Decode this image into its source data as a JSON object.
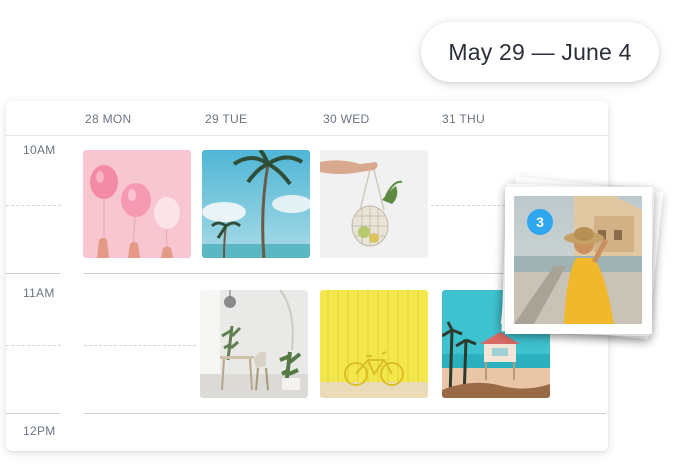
{
  "date_range": "May 29 — June 4",
  "days": [
    {
      "label": "28 MON"
    },
    {
      "label": "29 TUE"
    },
    {
      "label": "30 WED"
    },
    {
      "label": "31 THU"
    }
  ],
  "hours": [
    "10AM",
    "11AM",
    "12PM"
  ],
  "posts": [
    {
      "day": "28 MON",
      "time": "10AM",
      "image": "pink-balloons"
    },
    {
      "day": "29 TUE",
      "time": "10AM",
      "image": "palm-tree-sky"
    },
    {
      "day": "30 WED",
      "time": "10AM",
      "image": "mesh-bag-vegetables"
    },
    {
      "day": "29 TUE",
      "time": "11AM",
      "image": "white-interior-plants"
    },
    {
      "day": "30 WED",
      "time": "11AM",
      "image": "yellow-wall-bicycle"
    },
    {
      "day": "31 THU",
      "time": "11AM",
      "image": "beach-lifeguard-hut"
    }
  ],
  "dragged_post": {
    "image": "woman-yellow-dress-hat",
    "count": "3"
  },
  "colors": {
    "accent": "#2fa7ee",
    "text": "#2b2f3a",
    "muted": "#6b7480"
  }
}
